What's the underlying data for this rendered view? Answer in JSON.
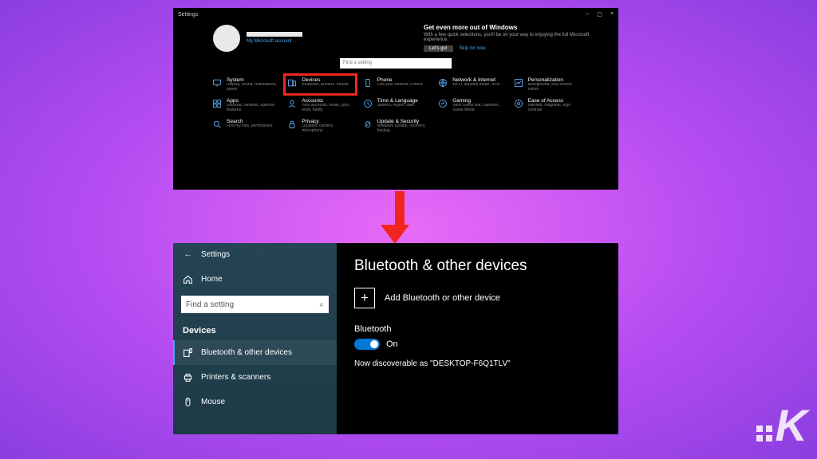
{
  "panel1": {
    "titlebar": {
      "title": "Settings",
      "minimize": "–",
      "maximize": "▢",
      "close": "×"
    },
    "user": {
      "name": "",
      "sub": "My Microsoft account"
    },
    "promo": {
      "title": "Get even more out of Windows",
      "desc": "With a few quick selections, you'll be on your way to enjoying the full Microsoft experience.",
      "cta": "Let's go!",
      "skip": "Skip for now"
    },
    "search_placeholder": "Find a setting",
    "tiles": [
      {
        "title": "System",
        "sub": "Display, sound, notifications, power",
        "icon": "system"
      },
      {
        "title": "Devices",
        "sub": "Bluetooth, printers, mouse",
        "icon": "devices",
        "highlight": true
      },
      {
        "title": "Phone",
        "sub": "Link your Android, iPhone",
        "icon": "phone"
      },
      {
        "title": "Network & Internet",
        "sub": "Wi-Fi, airplane mode, VPN",
        "icon": "network"
      },
      {
        "title": "Personalization",
        "sub": "Background, lock screen, colors",
        "icon": "personalization"
      },
      {
        "title": "Apps",
        "sub": "Uninstall, defaults, optional features",
        "icon": "apps"
      },
      {
        "title": "Accounts",
        "sub": "Your accounts, email, sync, work, family",
        "icon": "accounts"
      },
      {
        "title": "Time & Language",
        "sub": "Speech, region, date",
        "icon": "time"
      },
      {
        "title": "Gaming",
        "sub": "Xbox Game Bar, captures, Game Mode",
        "icon": "gaming"
      },
      {
        "title": "Ease of Access",
        "sub": "Narrator, magnifier, high contrast",
        "icon": "ease"
      },
      {
        "title": "Search",
        "sub": "Find my files, permissions",
        "icon": "search"
      },
      {
        "title": "Privacy",
        "sub": "Location, camera, microphone",
        "icon": "privacy"
      },
      {
        "title": "Update & Security",
        "sub": "Windows Update, recovery, backup",
        "icon": "update"
      }
    ]
  },
  "panel2": {
    "back": "Settings",
    "home": "Home",
    "search_placeholder": "Find a setting",
    "category": "Devices",
    "items": [
      {
        "label": "Bluetooth & other devices",
        "icon": "bluetooth",
        "active": true
      },
      {
        "label": "Printers & scanners",
        "icon": "printer"
      },
      {
        "label": "Mouse",
        "icon": "mouse"
      }
    ],
    "page_title": "Bluetooth & other devices",
    "add_label": "Add Bluetooth or other device",
    "bt_label": "Bluetooth",
    "bt_state": "On",
    "discoverable": "Now discoverable as \"DESKTOP-F6Q1TLV\""
  },
  "watermark": "K"
}
